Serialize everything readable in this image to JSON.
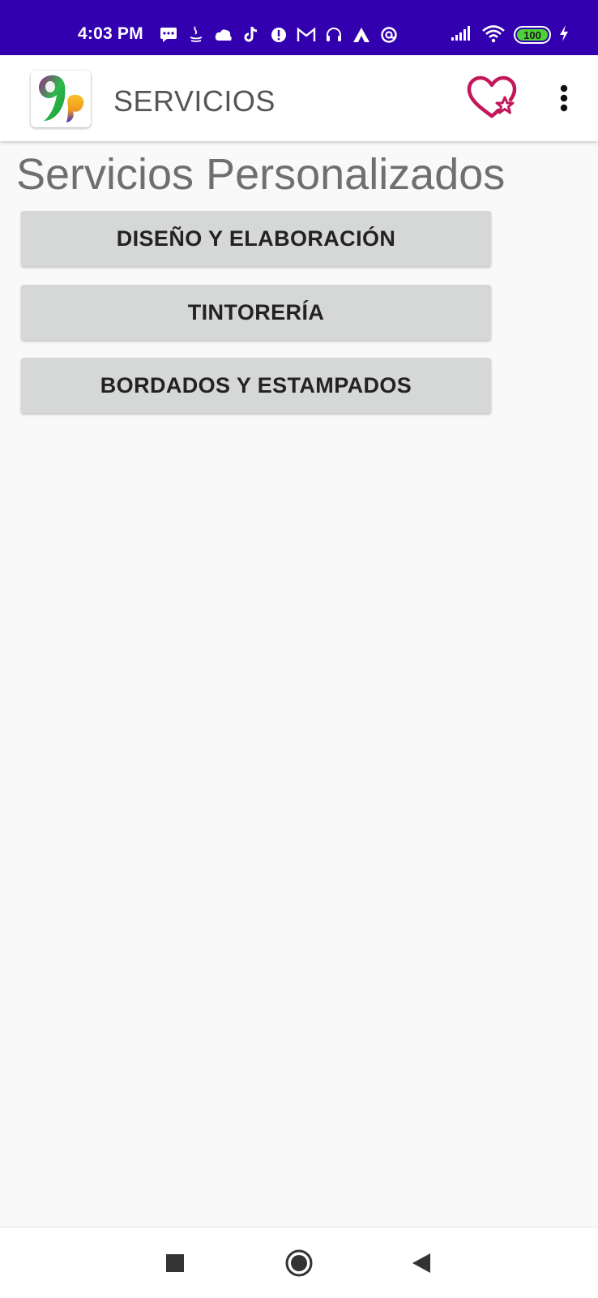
{
  "status_bar": {
    "time": "4:03 PM",
    "battery": "100",
    "colors": {
      "background": "#3300b0",
      "battery_fill": "#4cd137"
    },
    "notification_icons": [
      "message-icon",
      "java-icon",
      "cloud-icon",
      "tiktok-icon",
      "alert-icon",
      "gmail-icon",
      "headset-icon",
      "vpn-icon",
      "at-sign-icon"
    ],
    "system_icons": [
      "signal-icon",
      "wifi-icon",
      "battery-icon",
      "charging-icon"
    ]
  },
  "app_bar": {
    "title": "SERVICIOS",
    "logo_icon": "app-logo-icon",
    "favorite_icon": "heart-star-icon",
    "menu_icon": "more-vert-icon",
    "colors": {
      "favorite": "#c2185b"
    }
  },
  "main": {
    "heading": "Servicios Personalizados",
    "buttons": [
      {
        "label": "DISEÑO Y ELABORACIÓN"
      },
      {
        "label": "TINTORERÍA"
      },
      {
        "label": "BORDADOS Y ESTAMPADOS"
      }
    ]
  },
  "nav_bar": {
    "icons": [
      "recents-square-icon",
      "home-circle-icon",
      "back-triangle-icon"
    ]
  }
}
